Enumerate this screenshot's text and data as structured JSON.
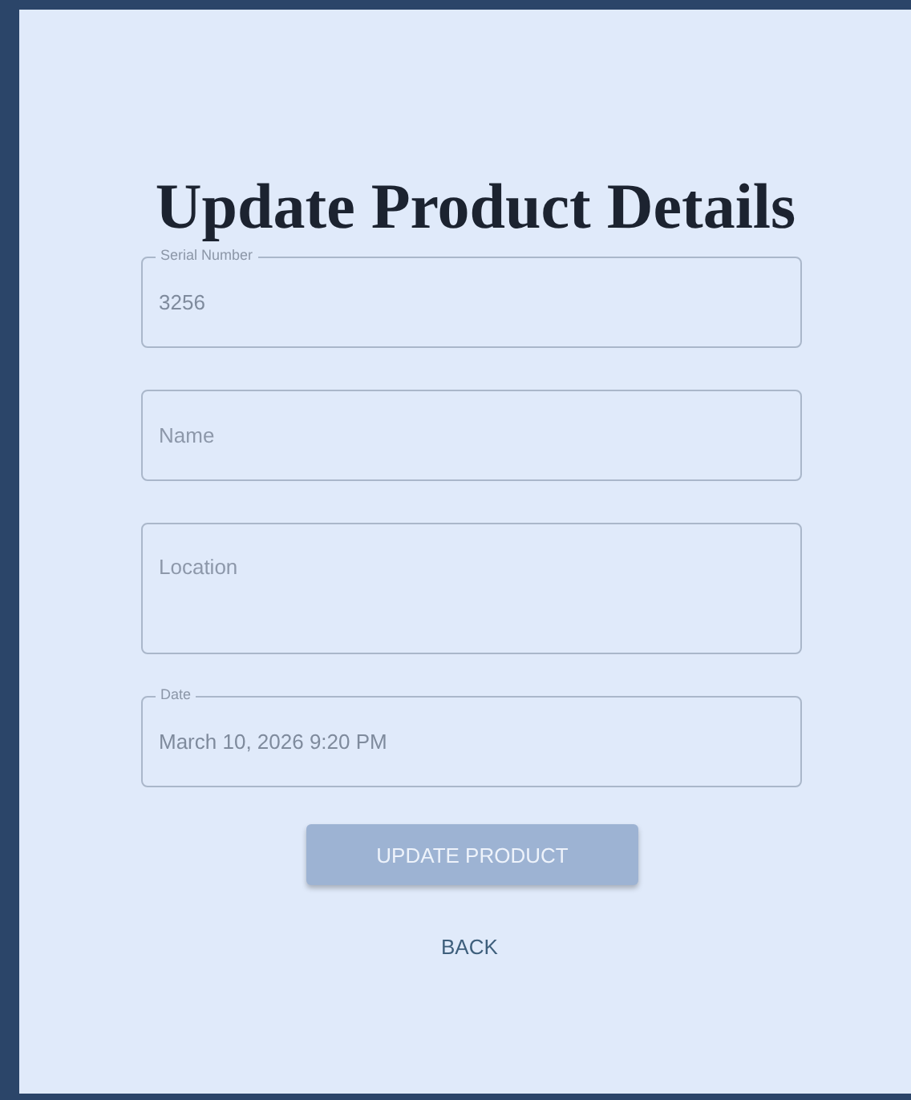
{
  "title": "Update Product Details",
  "fields": [
    {
      "label": "Serial Number",
      "value": "3256",
      "multiline": false
    },
    {
      "placeholder": "Name",
      "multiline": false
    },
    {
      "placeholder": "Location",
      "multiline": true
    },
    {
      "label": "Date",
      "value": "March 10, 2026 9:20 PM",
      "multiline": false
    }
  ],
  "submit_button": {
    "label": "UPDATE PRODUCT",
    "disabled": true
  },
  "back_link": {
    "label": "BACK"
  }
}
